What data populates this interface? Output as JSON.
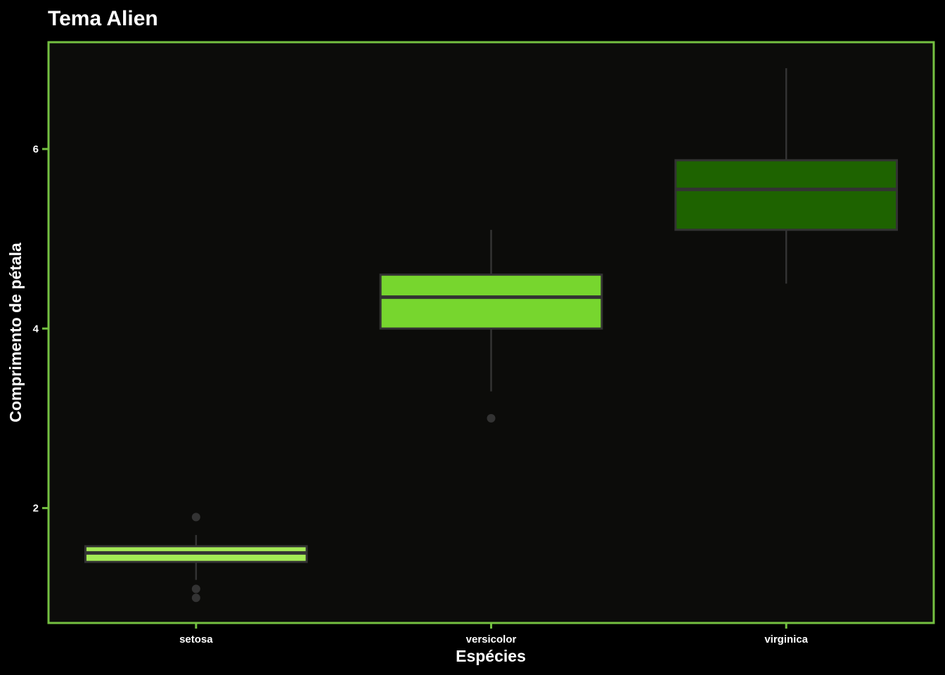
{
  "chart_data": {
    "type": "boxplot",
    "title": "Tema Alien",
    "xlabel": "Espécies",
    "ylabel": "Comprimento de pétala",
    "categories": [
      "setosa",
      "versicolor",
      "virginica"
    ],
    "ylim": [
      0.72,
      7.19
    ],
    "yticks": [
      2,
      4,
      6
    ],
    "grid": false,
    "boxes": [
      {
        "category": "setosa",
        "whisker_low": 1.2,
        "q1": 1.4,
        "median": 1.5,
        "q3": 1.575,
        "whisker_high": 1.7,
        "outliers": [
          1.0,
          1.1,
          1.9
        ],
        "fill": "#a4ea55"
      },
      {
        "category": "versicolor",
        "whisker_low": 3.3,
        "q1": 4.0,
        "median": 4.35,
        "q3": 4.6,
        "whisker_high": 5.1,
        "outliers": [
          3.0
        ],
        "fill": "#77d62e"
      },
      {
        "category": "virginica",
        "whisker_low": 4.5,
        "q1": 5.1,
        "median": 5.55,
        "q3": 5.875,
        "whisker_high": 6.9,
        "outliers": [],
        "fill": "#1e6300"
      }
    ],
    "colors": {
      "background": "#000000",
      "panel": "#0c0c0a",
      "panel_border": "#74c041",
      "box_outline": "#333333",
      "outlier": "#333333",
      "tick": "#74c041",
      "text": "#ffffff"
    }
  }
}
